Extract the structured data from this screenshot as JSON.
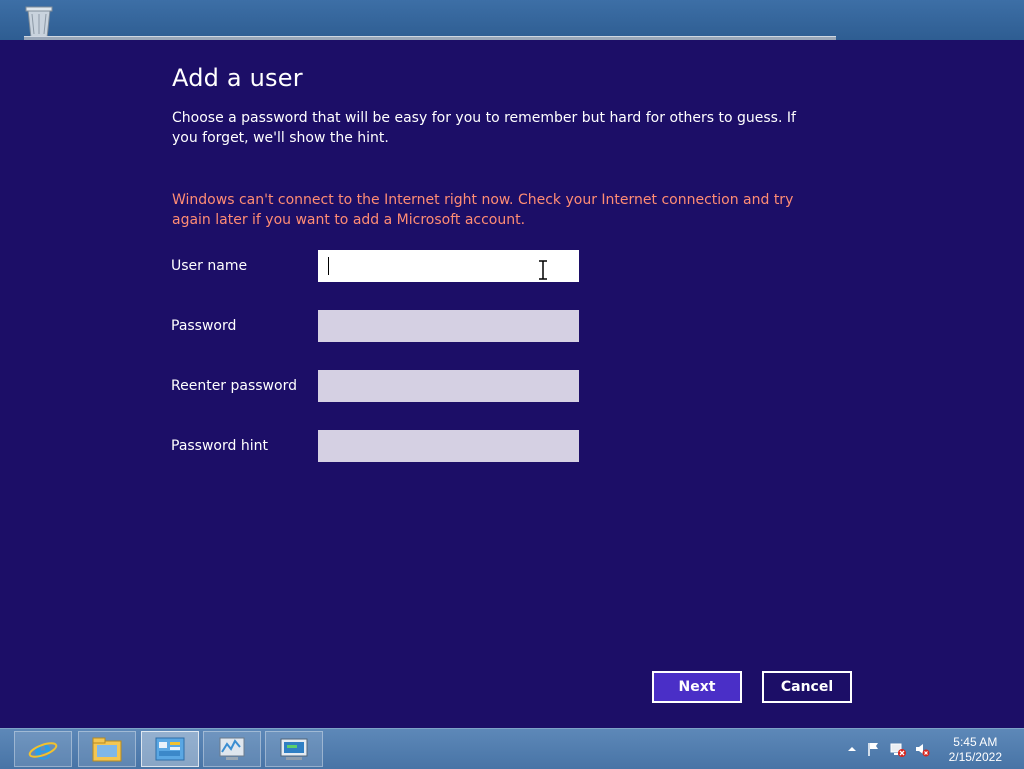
{
  "dialog": {
    "title": "Add a user",
    "description": "Choose a password that will be easy for you to remember but hard for others to guess. If you forget, we'll show the hint.",
    "warning": "Windows can't connect to the Internet right now. Check your Internet connection and try again later if you want to add a Microsoft account.",
    "fields": {
      "user_name": {
        "label": "User name",
        "value": ""
      },
      "password": {
        "label": "Password",
        "value": ""
      },
      "reenter_password": {
        "label": "Reenter password",
        "value": ""
      },
      "password_hint": {
        "label": "Password hint",
        "value": ""
      }
    },
    "buttons": {
      "next": "Next",
      "cancel": "Cancel"
    }
  },
  "taskbar": {
    "icons": [
      "internet-explorer-icon",
      "file-explorer-icon",
      "control-panel-icon",
      "performance-monitor-icon",
      "computer-management-icon"
    ],
    "active_index": 2
  },
  "tray": {
    "icons": [
      "show-hidden-icons",
      "action-center-flag-icon",
      "network-error-icon",
      "volume-muted-icon"
    ],
    "time": "5:45 AM",
    "date": "2/15/2022"
  },
  "colors": {
    "dialog_bg": "#1c0e67",
    "accent_button": "#4a2fc7",
    "warning_text": "#ff8c74",
    "input_inactive": "#d5d0e3"
  }
}
